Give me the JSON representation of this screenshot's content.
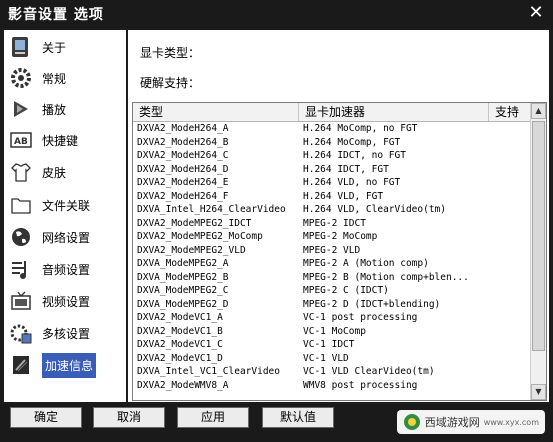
{
  "window": {
    "title": "影音设置 选项",
    "close_glyph": "✕"
  },
  "sidebar": {
    "items": [
      {
        "label": "关于",
        "icon": "about-icon"
      },
      {
        "label": "常规",
        "icon": "gear-icon"
      },
      {
        "label": "播放",
        "icon": "play-icon"
      },
      {
        "label": "快捷键",
        "icon": "keyboard-ab-icon"
      },
      {
        "label": "皮肤",
        "icon": "shirt-icon"
      },
      {
        "label": "文件关联",
        "icon": "folder-icon"
      },
      {
        "label": "网络设置",
        "icon": "globe-icon"
      },
      {
        "label": "音频设置",
        "icon": "audio-icon"
      },
      {
        "label": "视频设置",
        "icon": "tv-icon"
      },
      {
        "label": "多核设置",
        "icon": "multicore-icon"
      },
      {
        "label": "加速信息",
        "icon": "accelerate-icon",
        "active": true
      }
    ]
  },
  "main": {
    "gpu_type_label": "显卡类型：",
    "hw_decode_label": "硬解支持：",
    "table": {
      "columns": [
        "类型",
        "显卡加速器",
        "支持"
      ],
      "rows": [
        [
          "DXVA2_ModeH264_A",
          "H.264 MoComp, no FGT"
        ],
        [
          "DXVA2_ModeH264_B",
          "H.264 MoComp, FGT"
        ],
        [
          "DXVA2_ModeH264_C",
          "H.264 IDCT, no FGT"
        ],
        [
          "DXVA2_ModeH264_D",
          "H.264 IDCT, FGT"
        ],
        [
          "DXVA2_ModeH264_E",
          "H.264 VLD, no FGT"
        ],
        [
          "DXVA2_ModeH264_F",
          "H.264 VLD, FGT"
        ],
        [
          "DXVA_Intel_H264_ClearVideo",
          "H.264 VLD, ClearVideo(tm)"
        ],
        [
          "DXVA2_ModeMPEG2_IDCT",
          "MPEG-2 IDCT"
        ],
        [
          "DXVA2_ModeMPEG2_MoComp",
          "MPEG-2 MoComp"
        ],
        [
          "DXVA2_ModeMPEG2_VLD",
          "MPEG-2 VLD"
        ],
        [
          "DXVA_ModeMPEG2_A",
          "MPEG-2 A (Motion comp)"
        ],
        [
          "DXVA_ModeMPEG2_B",
          "MPEG-2 B (Motion comp+blen..."
        ],
        [
          "DXVA_ModeMPEG2_C",
          "MPEG-2 C (IDCT)"
        ],
        [
          "DXVA_ModeMPEG2_D",
          "MPEG-2 D (IDCT+blending)"
        ],
        [
          "DXVA2_ModeVC1_A",
          "VC-1 post processing"
        ],
        [
          "DXVA2_ModeVC1_B",
          "VC-1 MoComp"
        ],
        [
          "DXVA2_ModeVC1_C",
          "VC-1 IDCT"
        ],
        [
          "DXVA2_ModeVC1_D",
          "VC-1 VLD"
        ],
        [
          "DXVA_Intel_VC1_ClearVideo",
          "VC-1 VLD ClearVideo(tm)"
        ],
        [
          "DXVA2_ModeWMV8_A",
          "WMV8 post processing"
        ]
      ]
    }
  },
  "buttons": {
    "ok": "确定",
    "cancel": "取消",
    "apply": "应用",
    "default": "默认值"
  },
  "watermark": {
    "text": "西域游戏网",
    "sub": "www.xyx.com"
  }
}
